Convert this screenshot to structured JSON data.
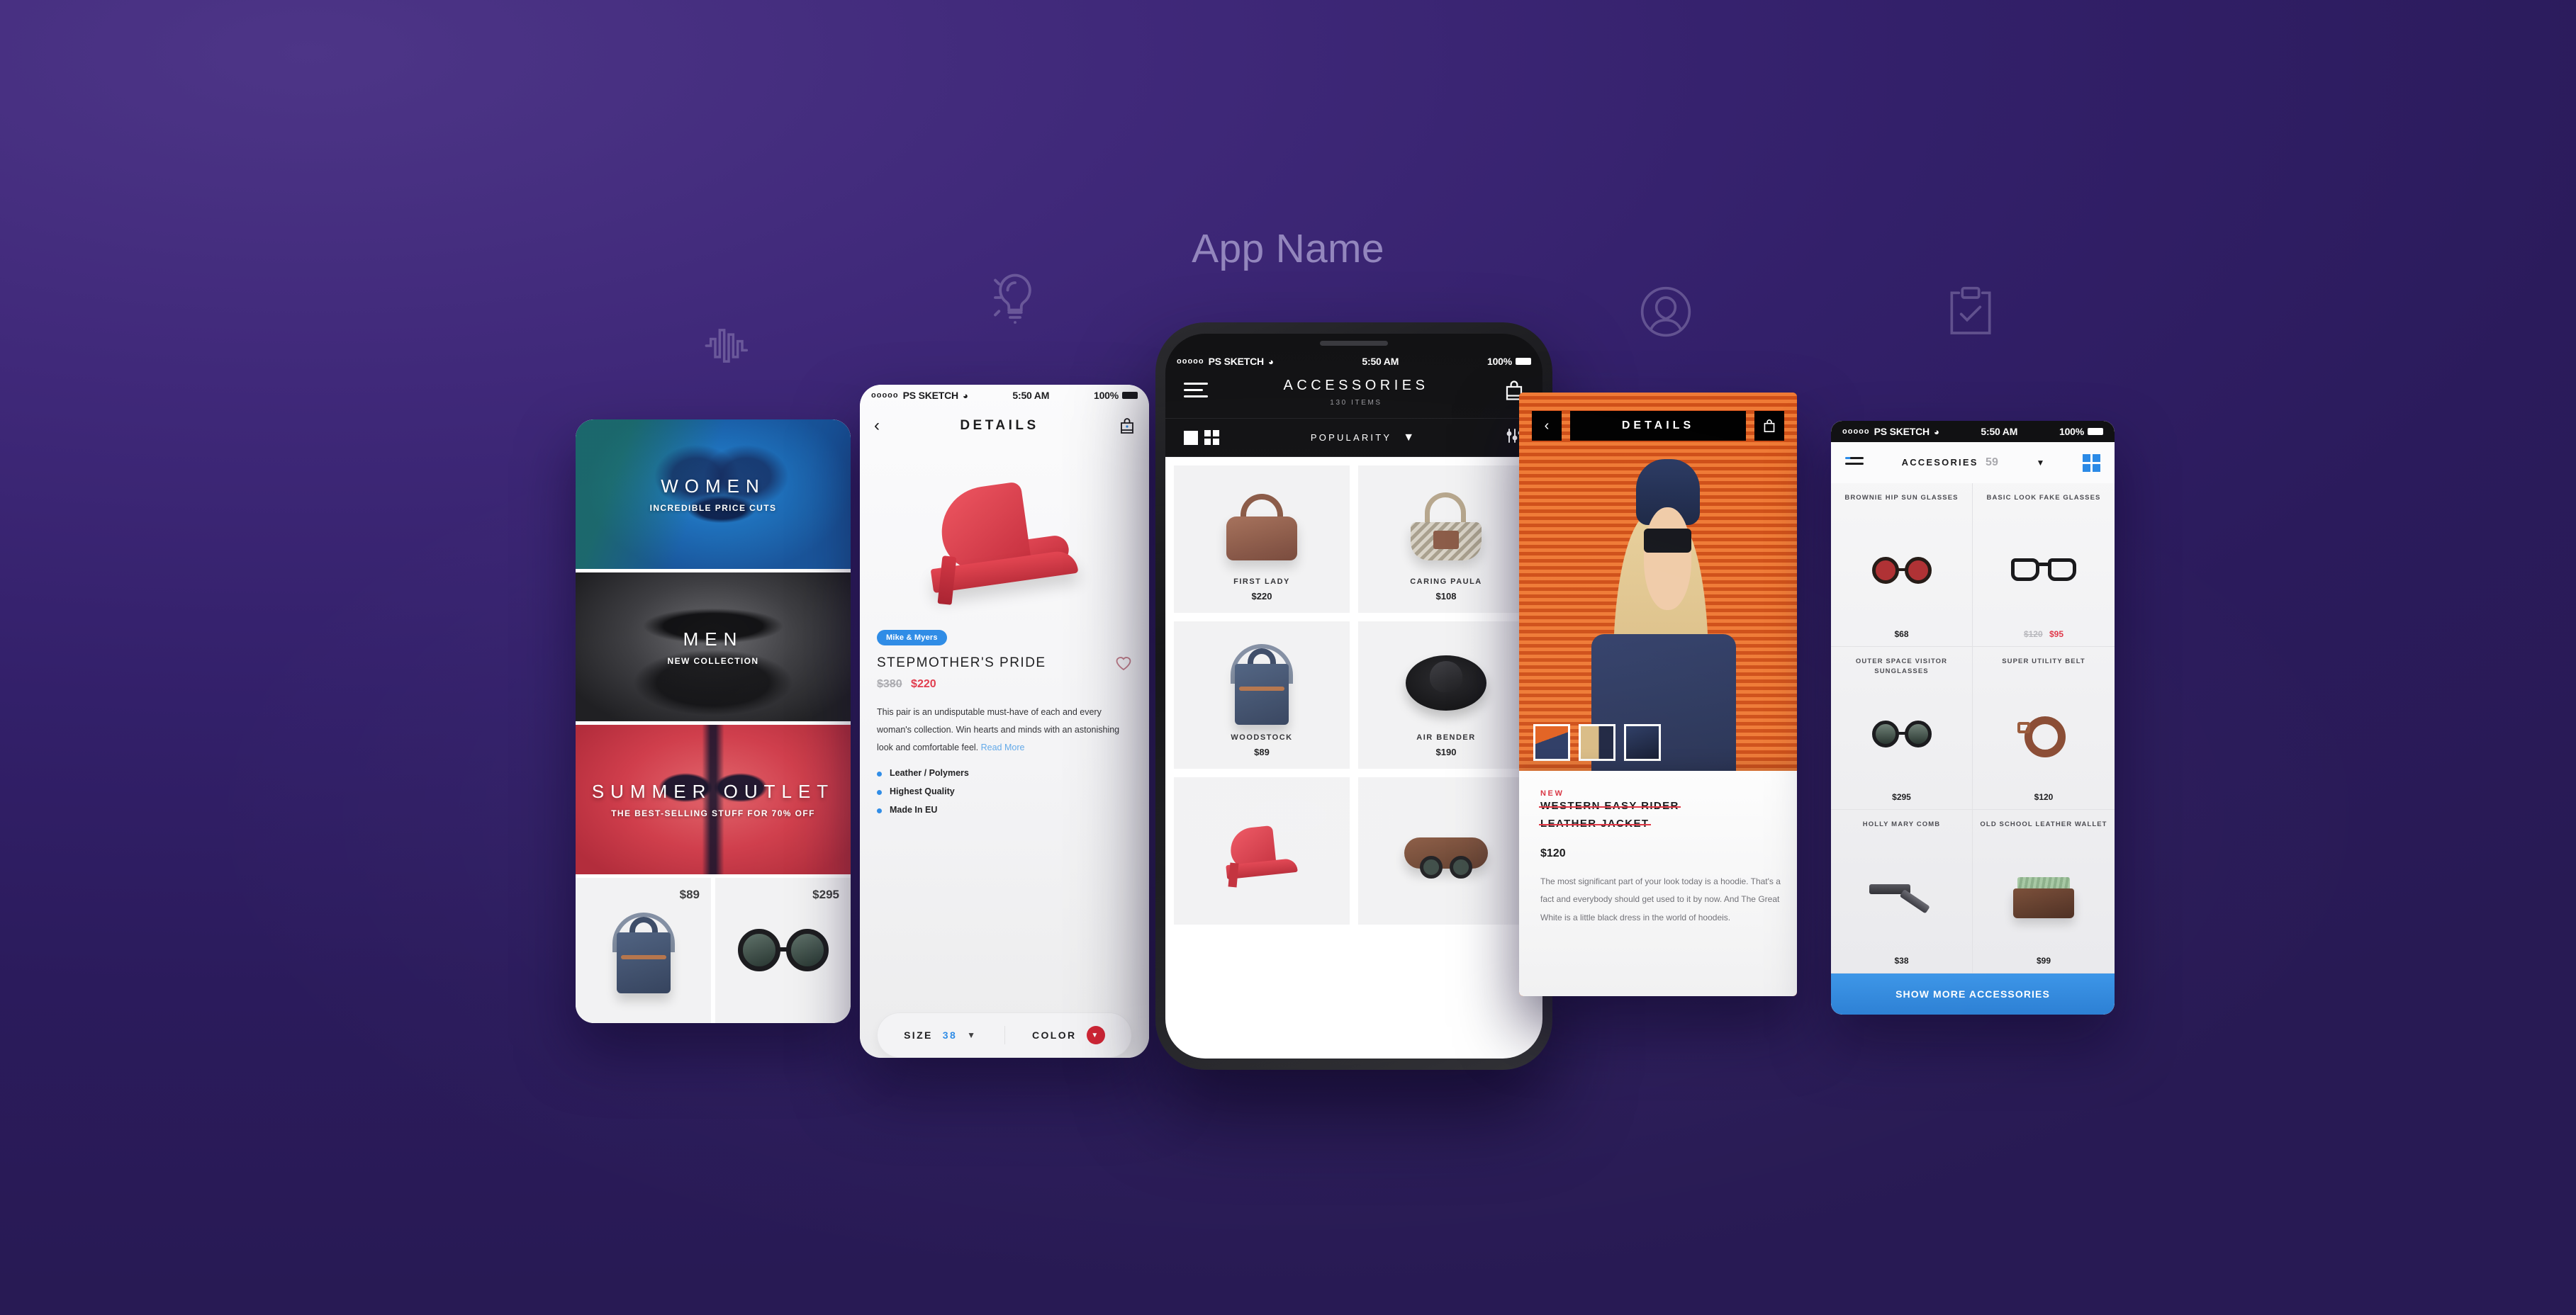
{
  "page": {
    "app_title": "App Name",
    "background_color": "#33206a",
    "accent_blue": "#2b8ae6",
    "accent_red": "#e0384a",
    "accent_orange": "#e0601f"
  },
  "decor_icons": [
    {
      "name": "sound-wave-icon"
    },
    {
      "name": "lightbulb-icon"
    },
    {
      "name": "user-profile-icon"
    },
    {
      "name": "clipboard-check-icon"
    }
  ],
  "status_bar": {
    "carrier": "PS SKETCH",
    "dots": "ooooo",
    "wifi": "wifi-icon",
    "time": "5:50 AM",
    "battery": "100%"
  },
  "phone_categories": {
    "banners": [
      {
        "title": "WOMEN",
        "subtitle": "INCREDIBLE PRICE CUTS"
      },
      {
        "title": "MEN",
        "subtitle": "NEW COLLECTION"
      },
      {
        "title": "SUMMER OUTLET",
        "subtitle": "THE BEST-SELLING STUFF FOR 70% OFF"
      }
    ],
    "products": [
      {
        "price": "$89",
        "art": "tote-bag"
      },
      {
        "price": "$295",
        "art": "round-sunglasses"
      }
    ]
  },
  "phone_details_light": {
    "nav": {
      "back": "chevron-left-icon",
      "title": "DETAILS",
      "bag": "shopping-bag-icon"
    },
    "hero_art": "red-high-heel",
    "brand": "Mike & Myers",
    "product_name": "STEPMOTHER'S PRIDE",
    "old_price": "$380",
    "new_price": "$220",
    "favorite": "heart-icon",
    "description": "This pair is an undisputable must-have of each and every woman's collection. Win hearts and minds with an astonishing look and comfortable feel.",
    "read_more": "Read More",
    "features": [
      "Leather / Polymers",
      "Highest Quality",
      "Made In EU"
    ],
    "size_label": "SIZE",
    "size_value": "38",
    "color_label": "COLOR",
    "color_value": "#cf2030"
  },
  "phone_accessories": {
    "menu": "hamburger-menu-icon",
    "title": "ACCESSORIES",
    "item_count": "130 ITEMS",
    "bag": "shopping-bag-icon",
    "view_single": "single-column-view-icon",
    "view_grid": "grid-view-icon",
    "sort_label": "POPULARITY",
    "sort_chevron": "chevron-down-icon",
    "filter": "sliders-filter-icon",
    "products": [
      {
        "name": "FIRST LADY",
        "price": "$220",
        "art": "doctor-bag"
      },
      {
        "name": "CARING PAULA",
        "price": "$108",
        "art": "straw-basket-bag"
      },
      {
        "name": "WOODSTOCK",
        "price": "$89",
        "art": "denim-tote"
      },
      {
        "name": "AIR BENDER",
        "price": "$190",
        "art": "black-fedora-hat"
      },
      {
        "name": "",
        "price": "",
        "art": "red-pump-shoe"
      },
      {
        "name": "",
        "price": "",
        "art": "sunglasses-case"
      }
    ]
  },
  "phone_details_orange": {
    "nav": {
      "back": "chevron-left-icon",
      "title": "DETAILS",
      "bag": "shopping-bag-icon"
    },
    "thumbnails": [
      "model-full-thumb",
      "detail-zip-thumb",
      "jacket-detail-thumb"
    ],
    "badge": "NEW",
    "product_name_line1": "WESTERN EASY RIDER",
    "product_name_line2": "LEATHER JACKET",
    "price": "$120",
    "description": "The most significant part of your look today is a hoodie. That's a fact and everybody should get used to it by now. And The Great White is a little black dress in the world of hoodeis."
  },
  "phone_acc_list": {
    "list_icon": "list-view-icon",
    "title": "ACCESORIES",
    "count": "59",
    "chevron": "chevron-down-icon",
    "grid_icon": "grid-view-icon",
    "products": [
      {
        "name": "BROWNIE HIP SUN GLASSES",
        "price": "$68",
        "old_price": "",
        "art": "brown-round-sunglasses"
      },
      {
        "name": "BASIC LOOK FAKE GLASSES",
        "price": "$95",
        "old_price": "$120",
        "art": "wayfarer-glasses"
      },
      {
        "name": "OUTER SPACE VISITOR SUNGLASSES",
        "price": "$295",
        "old_price": "",
        "art": "round-sunglasses"
      },
      {
        "name": "SUPER UTILITY BELT",
        "price": "$120",
        "old_price": "",
        "art": "leather-belt"
      },
      {
        "name": "HOLLY MARY COMB",
        "price": "$38",
        "old_price": "",
        "art": "folding-comb"
      },
      {
        "name": "OLD SCHOOL LEATHER WALLET",
        "price": "$99",
        "old_price": "",
        "art": "leather-wallet"
      }
    ],
    "cta": "SHOW MORE ACCESSORIES"
  }
}
